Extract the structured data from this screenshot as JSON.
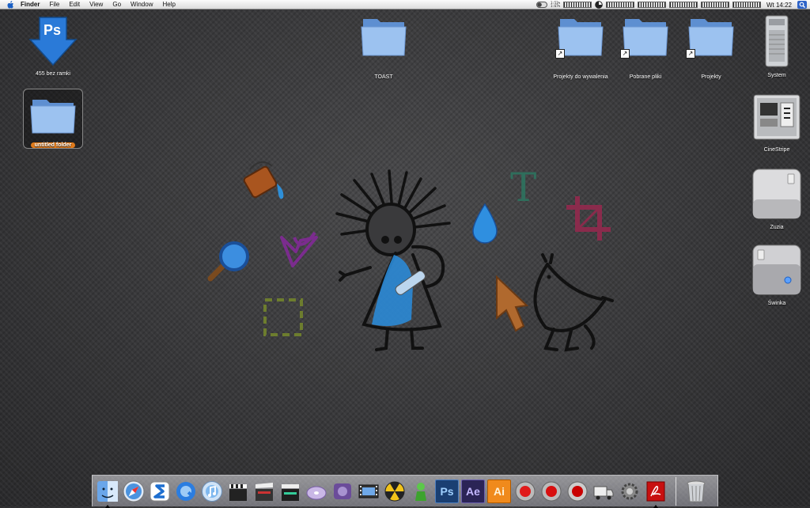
{
  "menubar": {
    "app_name": "Finder",
    "items": [
      "File",
      "Edit",
      "View",
      "Go",
      "Window",
      "Help"
    ],
    "cpu_readout": [
      "1:51%",
      "1:67%"
    ],
    "clock": "Wt 14:22"
  },
  "desktop": {
    "icons": [
      {
        "name": "455 bez ramki",
        "kind": "photoshop-document"
      },
      {
        "name": "untitled folder",
        "kind": "folder",
        "selected": true
      },
      {
        "name": "TOAST",
        "kind": "folder"
      },
      {
        "name": "Projekty do wywalenia",
        "kind": "folder-alias"
      },
      {
        "name": "Pobrane pliki",
        "kind": "folder-alias"
      },
      {
        "name": "Projekty",
        "kind": "folder-alias"
      },
      {
        "name": "System",
        "kind": "mac-pro"
      },
      {
        "name": "CineStripe",
        "kind": "drive"
      },
      {
        "name": "Zuzia",
        "kind": "external-drive"
      },
      {
        "name": "Świnka",
        "kind": "external-drive"
      }
    ],
    "ps_badge": "Ps"
  },
  "dock": {
    "apps": [
      {
        "icon": "finder-icon"
      },
      {
        "icon": "safari-icon"
      },
      {
        "icon": "blue-s-app-icon"
      },
      {
        "icon": "quicktime-icon"
      },
      {
        "icon": "itunes-icon"
      },
      {
        "icon": "clapper-icon"
      },
      {
        "icon": "final-cut-clapper-icon"
      },
      {
        "icon": "motion-clapper-icon"
      },
      {
        "icon": "dvd-studio-icon"
      },
      {
        "icon": "compressor-icon"
      },
      {
        "icon": "film-icon"
      },
      {
        "icon": "nuke-icon"
      },
      {
        "icon": "green-figure-icon"
      },
      {
        "icon": "photoshop-icon",
        "label": "Ps"
      },
      {
        "icon": "after-effects-icon",
        "label": "Ae"
      },
      {
        "icon": "illustrator-icon",
        "label": "Ai"
      },
      {
        "icon": "red-app-1-icon"
      },
      {
        "icon": "red-app-2-icon"
      },
      {
        "icon": "red-app-3-icon"
      },
      {
        "icon": "truck-icon"
      },
      {
        "icon": "gear-settings-icon"
      },
      {
        "icon": "acrobat-icon"
      }
    ],
    "trash": "trash-icon"
  },
  "colors": {
    "selection_label": "#e07a1a",
    "folder_blue": "#8fb6e8",
    "ps_blue": "#2a7ad8",
    "ai_orange": "#f08a1c"
  }
}
